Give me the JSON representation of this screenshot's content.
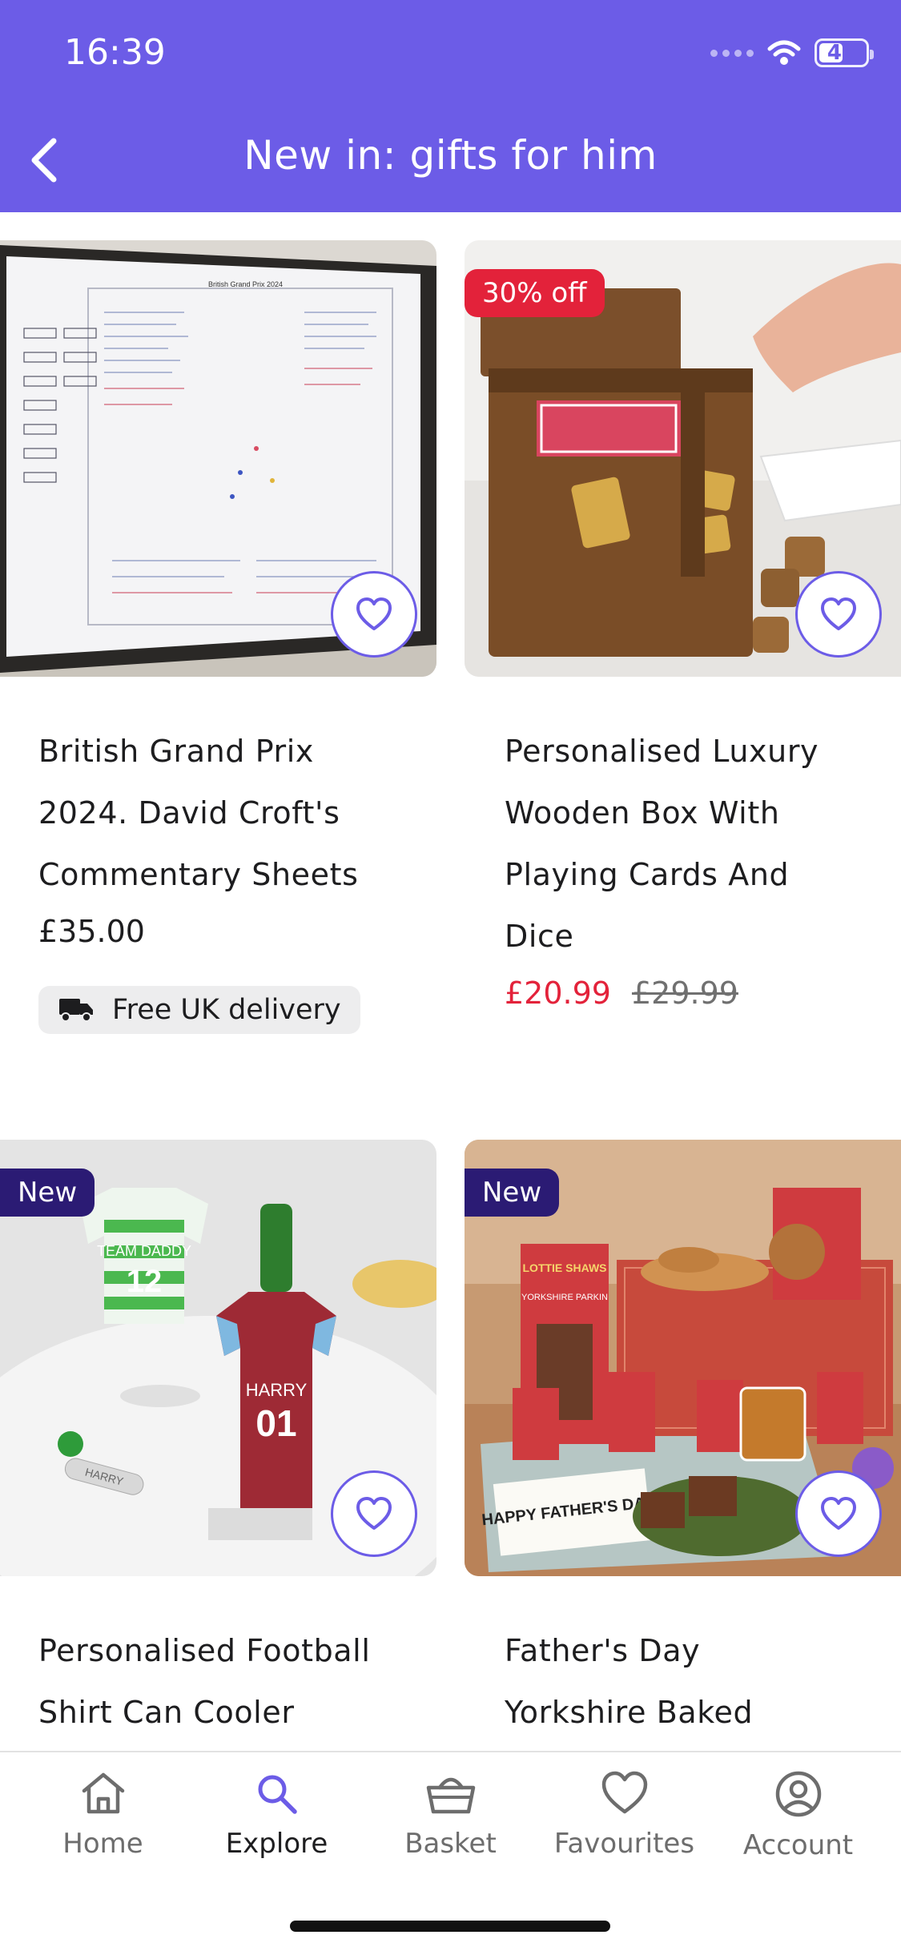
{
  "status_bar": {
    "time": "16:39",
    "battery": "47",
    "battery_level": 0.47
  },
  "header": {
    "title": "New in: gifts for him"
  },
  "products": [
    {
      "title_lines": [
        "British Grand Prix",
        "2024. David Croft's",
        "Commentary Sheets"
      ],
      "price": "£35.00",
      "delivery": "Free UK delivery"
    },
    {
      "badge": "30% off",
      "title_lines": [
        "Personalised Luxury",
        "Wooden Box With",
        "Playing Cards And",
        "Dice"
      ],
      "sale_price": "£20.99",
      "old_price": "£29.99"
    },
    {
      "badge": "New",
      "title_lines": [
        "Personalised Football",
        "Shirt Can Cooler"
      ]
    },
    {
      "badge": "New",
      "title_lines": [
        "Father's Day",
        "Yorkshire Baked"
      ]
    }
  ],
  "image_texts": {
    "commentary_sheet_title": "British Grand Prix 2024",
    "jersey_green_name": "TEAM DADDY",
    "jersey_green_number": "12",
    "jersey_red_name": "HARRY",
    "jersey_red_number": "01",
    "opener_engraving": "HARRY",
    "brand": "LOTTIE SHAWS",
    "product_parkin": "YORKSHIRE PARKIN",
    "card_text": "HAPPY FATHER'S DAY"
  },
  "nav": {
    "items": [
      {
        "label": "Home",
        "icon": "home-icon"
      },
      {
        "label": "Explore",
        "icon": "search-icon"
      },
      {
        "label": "Basket",
        "icon": "basket-icon"
      },
      {
        "label": "Favourites",
        "icon": "heart-icon"
      },
      {
        "label": "Account",
        "icon": "account-icon"
      }
    ],
    "active": "Explore"
  },
  "colors": {
    "brand": "#6c5ce7",
    "sale": "#e3223a",
    "new_badge": "#2b1b74"
  }
}
